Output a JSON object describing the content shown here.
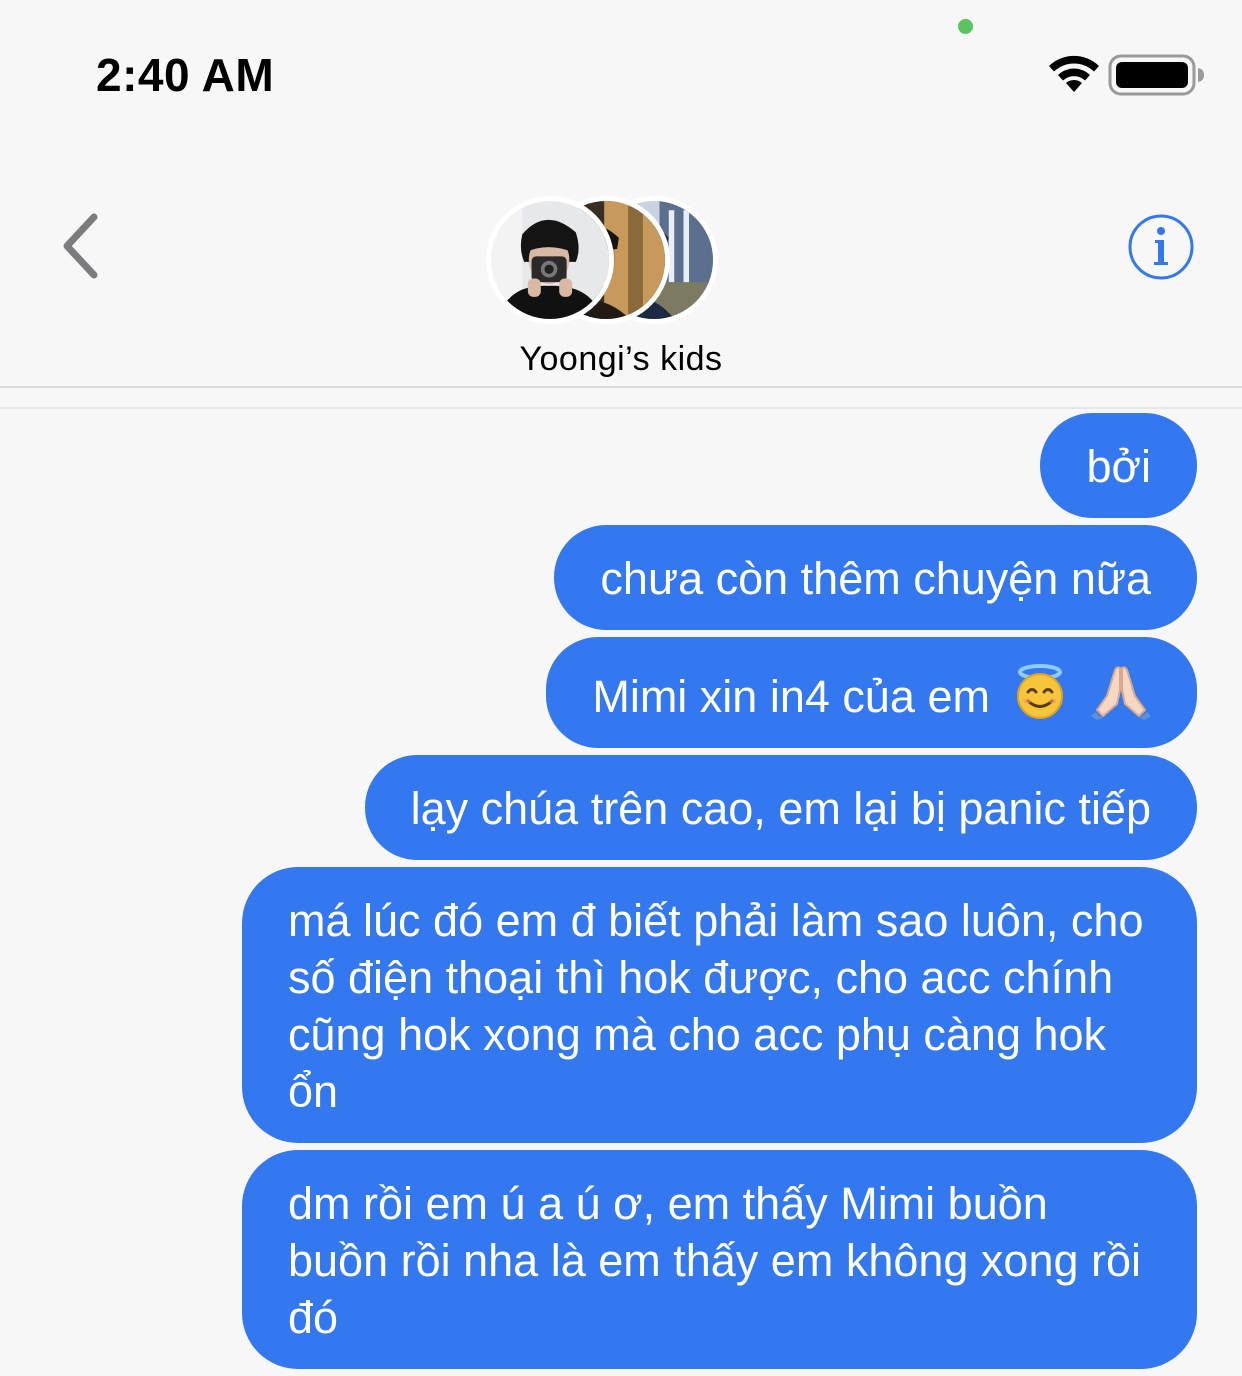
{
  "status_bar": {
    "time": "2:40 AM",
    "indicator_color": "#5ac461"
  },
  "header": {
    "group_name": "Yoongi’s kids",
    "accent_color": "#3478f0",
    "back_icon": "chevron-left-icon",
    "info_icon": "info-circle-icon",
    "avatars": [
      "avatar-member-1",
      "avatar-member-2",
      "avatar-member-3"
    ]
  },
  "messages": [
    {
      "sender": "me",
      "text": "bởi"
    },
    {
      "sender": "me",
      "text": "chưa còn thêm chuyện nữa"
    },
    {
      "sender": "me",
      "text": "Mimi xin in4 của em",
      "emojis": [
        "smiling-face-with-halo-emoji",
        "folded-hands-emoji"
      ]
    },
    {
      "sender": "me",
      "text": "lạy chúa trên cao, em lại bị panic tiếp"
    },
    {
      "sender": "me",
      "text": "má lúc đó em đ biết phải làm sao luôn, cho số điện thoại thì hok được, cho acc chính cũng hok xong mà cho acc phụ càng hok ổn"
    },
    {
      "sender": "me",
      "text": "dm rồi em ú a ú ơ, em thấy Mimi buồn buồn rồi nha là em thấy em không xong rồi đó"
    }
  ],
  "bubble_color": "#3478f0"
}
